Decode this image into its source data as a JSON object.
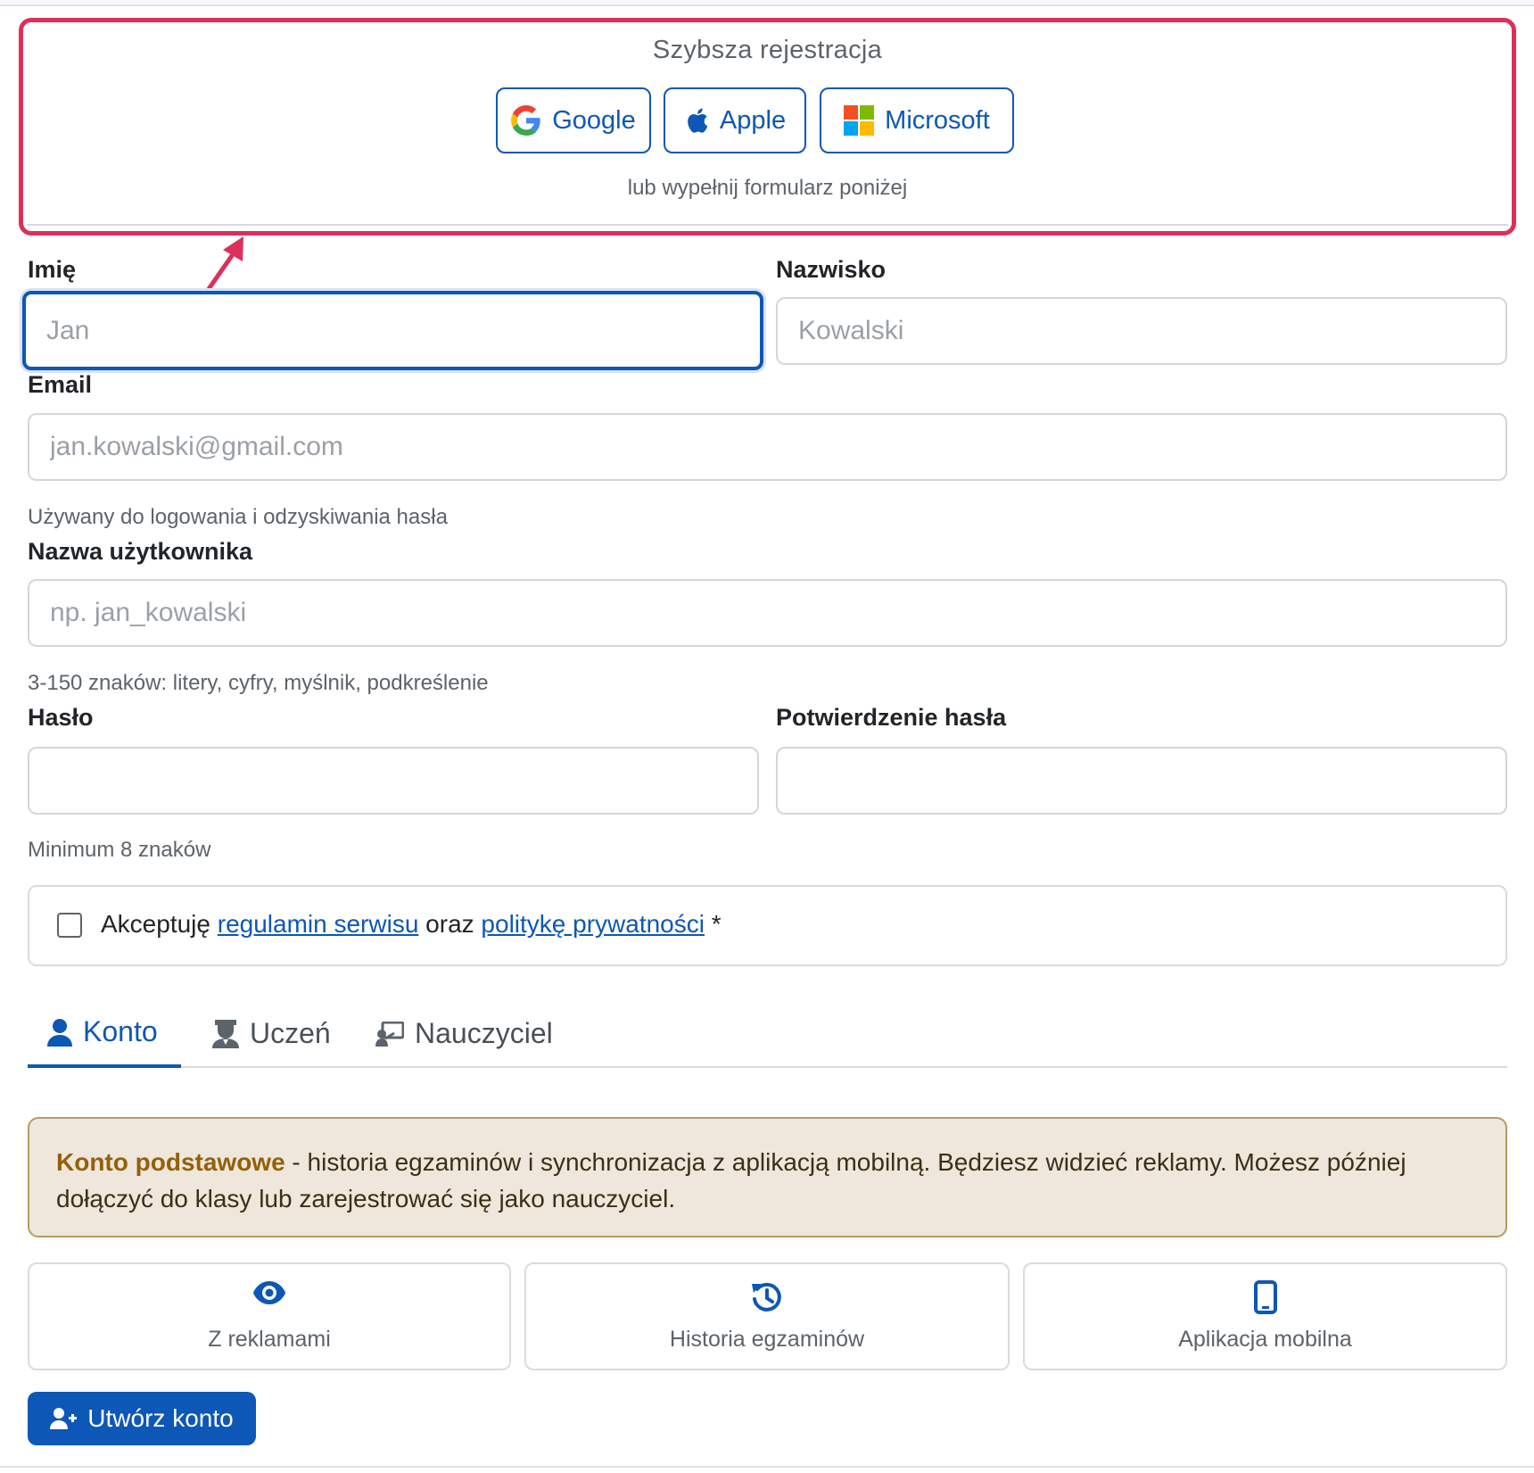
{
  "social": {
    "title": "Szybsza rejestracja",
    "google_label": "Google",
    "apple_label": "Apple",
    "microsoft_label": "Microsoft",
    "note": "lub wypełnij formularz poniżej"
  },
  "form": {
    "first_name": {
      "label": "Imię",
      "placeholder": "Jan",
      "value": ""
    },
    "last_name": {
      "label": "Nazwisko",
      "placeholder": "Kowalski",
      "value": ""
    },
    "email": {
      "label": "Email",
      "placeholder": "jan.kowalski@gmail.com",
      "help": "Używany do logowania i odzyskiwania hasła"
    },
    "username": {
      "label": "Nazwa użytkownika",
      "placeholder": "np. jan_kowalski",
      "help": "3-150 znaków: litery, cyfry, myślnik, podkreślenie"
    },
    "password": {
      "label": "Hasło",
      "help": "Minimum 8 znaków"
    },
    "password_confirm": {
      "label": "Potwierdzenie hasła"
    }
  },
  "terms": {
    "prefix": "Akceptuję",
    "link1": "regulamin serwisu",
    "middle": "oraz",
    "link2": "politykę prywatności",
    "suffix": "*",
    "checked": false
  },
  "tabs": [
    {
      "label": "Konto",
      "icon": "user-icon",
      "active": true
    },
    {
      "label": "Uczeń",
      "icon": "student-icon",
      "active": false
    },
    {
      "label": "Nauczyciel",
      "icon": "teacher-icon",
      "active": false
    }
  ],
  "alert": {
    "title": "Konto podstawowe",
    "text": " - historia egzaminów i synchronizacja z aplikacją mobilną. Będziesz widzieć reklamy. Możesz później dołączyć do klasy lub zarejestrować się jako nauczyciel."
  },
  "features": [
    {
      "label": "Z reklamami",
      "icon": "eye-icon"
    },
    {
      "label": "Historia egzaminów",
      "icon": "history-icon"
    },
    {
      "label": "Aplikacja mobilna",
      "icon": "mobile-icon"
    }
  ],
  "submit": {
    "label": "Utwórz konto",
    "icon": "user-plus-icon"
  },
  "colors": {
    "primary": "#0d57b6",
    "highlight_border": "#dc2f5a",
    "alert_bg": "#efe7db",
    "alert_title": "#94600a"
  }
}
